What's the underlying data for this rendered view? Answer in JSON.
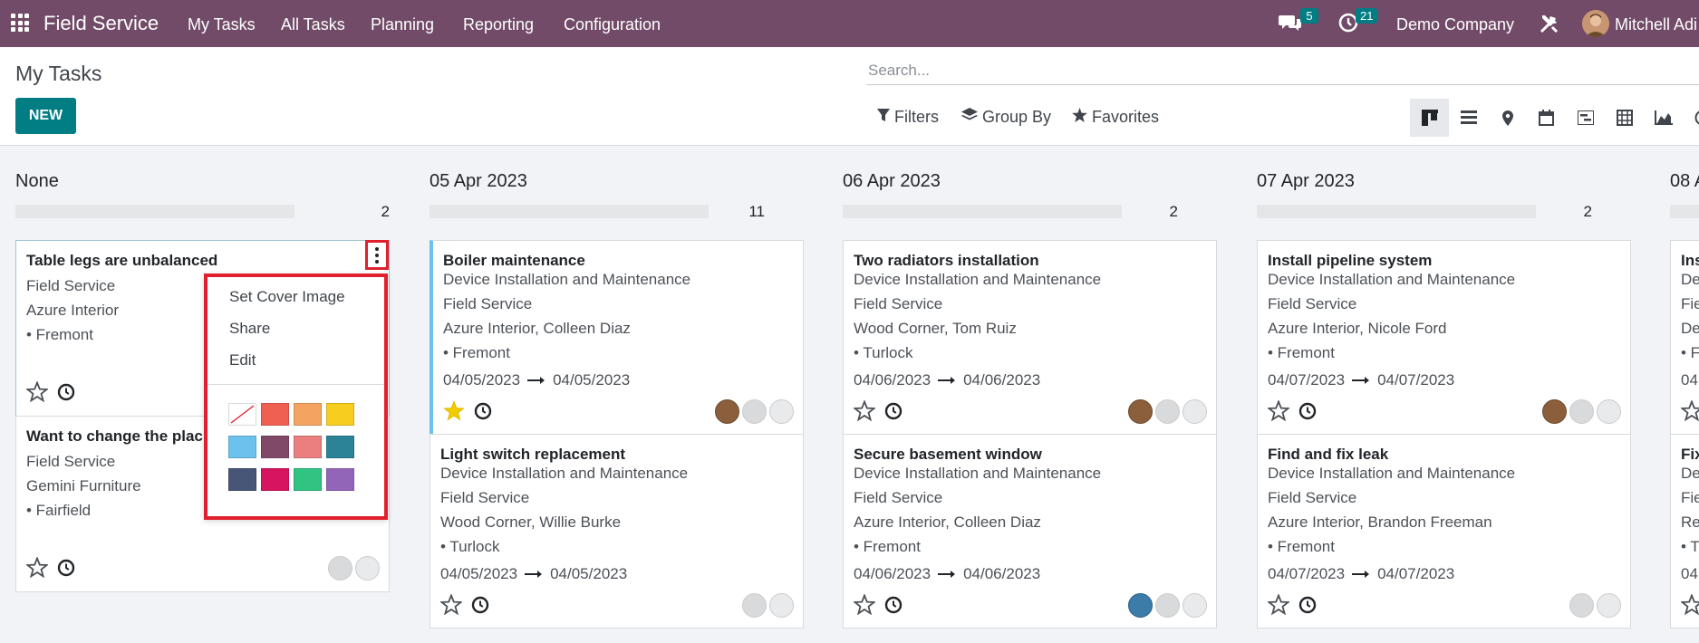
{
  "navbar": {
    "app_name": "Field Service",
    "menu": [
      "My Tasks",
      "All Tasks",
      "Planning",
      "Reporting",
      "Configuration"
    ],
    "messages_count": "5",
    "activities_count": "21",
    "company": "Demo Company",
    "user": "Mitchell Adi"
  },
  "control_panel": {
    "title": "My Tasks",
    "new_label": "NEW",
    "search_placeholder": "Search...",
    "filters_label": "Filters",
    "group_by_label": "Group By",
    "favorites_label": "Favorites",
    "views": [
      "kanban",
      "list",
      "map",
      "calendar",
      "gantt",
      "pivot",
      "graph",
      "activity"
    ]
  },
  "columns": [
    {
      "title": "None",
      "count": "2",
      "cards": [
        {
          "name": "Table legs are unbalanced",
          "lines": [
            "Field Service",
            "Azure Interior",
            "• Fremont"
          ]
        },
        {
          "name": "Want to change the plac",
          "lines": [
            "Field Service",
            "Gemini Furniture",
            "• Fairfield"
          ]
        }
      ]
    },
    {
      "title": "05 Apr 2023",
      "count": "11",
      "cards": [
        {
          "name": "Boiler maintenance",
          "lines": [
            "Device Installation and Maintenance",
            "Field Service",
            "Azure Interior, Colleen Diaz",
            "• Fremont"
          ],
          "date_from": "04/05/2023",
          "date_to": "04/05/2023"
        },
        {
          "name": "Light switch replacement",
          "lines": [
            "Device Installation and Maintenance",
            "Field Service",
            "Wood Corner, Willie Burke",
            "• Turlock"
          ],
          "date_from": "04/05/2023",
          "date_to": "04/05/2023"
        }
      ]
    },
    {
      "title": "06 Apr 2023",
      "count": "2",
      "cards": [
        {
          "name": "Two radiators installation",
          "lines": [
            "Device Installation and Maintenance",
            "Field Service",
            "Wood Corner, Tom Ruiz",
            "• Turlock"
          ],
          "date_from": "04/06/2023",
          "date_to": "04/06/2023"
        },
        {
          "name": "Secure basement window",
          "lines": [
            "Device Installation and Maintenance",
            "Field Service",
            "Azure Interior, Colleen Diaz",
            "• Fremont"
          ],
          "date_from": "04/06/2023",
          "date_to": "04/06/2023"
        }
      ]
    },
    {
      "title": "07 Apr 2023",
      "count": "2",
      "cards": [
        {
          "name": "Install pipeline system",
          "lines": [
            "Device Installation and Maintenance",
            "Field Service",
            "Azure Interior, Nicole Ford",
            "• Fremont"
          ],
          "date_from": "04/07/2023",
          "date_to": "04/07/2023"
        },
        {
          "name": "Find and fix leak",
          "lines": [
            "Device Installation and Maintenance",
            "Field Service",
            "Azure Interior, Brandon Freeman",
            "• Fremont"
          ],
          "date_from": "04/07/2023",
          "date_to": "04/07/2023"
        }
      ]
    },
    {
      "title": "08 A",
      "cards": [
        {
          "name": "Ins",
          "lines": [
            "De",
            "Fie",
            "De",
            "• F"
          ],
          "date_from": "04"
        },
        {
          "name": "Fix",
          "lines": [
            "De",
            "Fie",
            "Re",
            "• T"
          ],
          "date_from": "04"
        }
      ]
    }
  ],
  "dropdown": {
    "items": [
      "Set Cover Image",
      "Share",
      "Edit"
    ],
    "colors": [
      "none",
      "#f06050",
      "#f4a460",
      "#f7cd1f",
      "#6cc1ed",
      "#814968",
      "#eb7e7f",
      "#2c8397",
      "#475577",
      "#d6145f",
      "#30c381",
      "#9365b8"
    ]
  }
}
